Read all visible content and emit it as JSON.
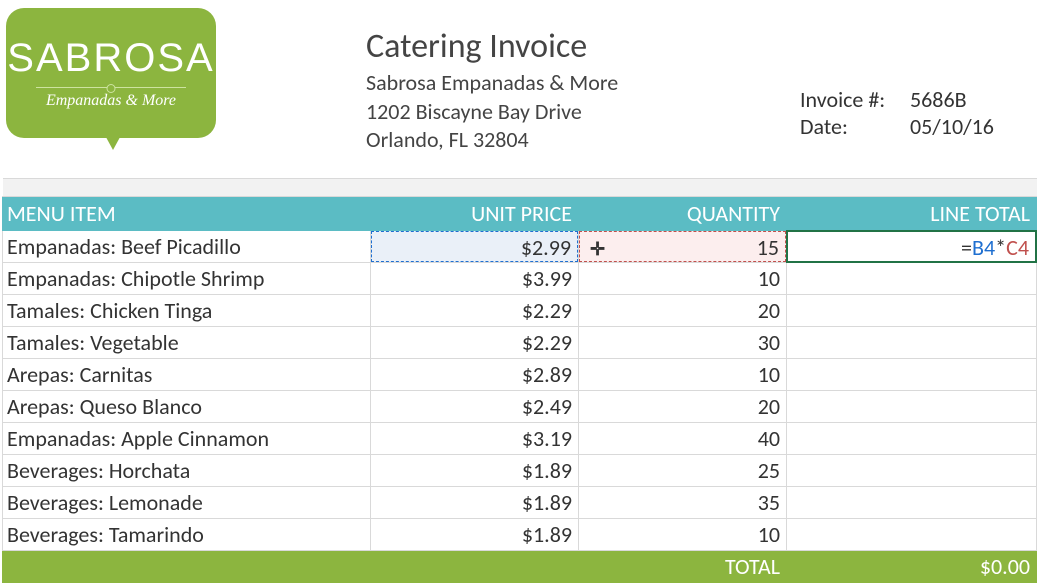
{
  "logo": {
    "title": "SABROSA",
    "subtitle": "Empanadas & More"
  },
  "vendor": {
    "title": "Catering Invoice",
    "name": "Sabrosa Empanadas & More",
    "addr1": "1202 Biscayne Bay Drive",
    "addr2": "Orlando, FL 32804"
  },
  "meta": {
    "invoice_label": "Invoice #:",
    "invoice_value": "5686B",
    "date_label": "Date:",
    "date_value": "05/10/16"
  },
  "columns": {
    "menu": "MENU ITEM",
    "unit": "UNIT PRICE",
    "qty": "QUANTITY",
    "line": "LINE TOTAL"
  },
  "rows": [
    {
      "menu": "Empanadas: Beef Picadillo",
      "unit": "$2.99",
      "qty": "15"
    },
    {
      "menu": "Empanadas: Chipotle Shrimp",
      "unit": "$3.99",
      "qty": "10"
    },
    {
      "menu": "Tamales: Chicken Tinga",
      "unit": "$2.29",
      "qty": "20"
    },
    {
      "menu": "Tamales: Vegetable",
      "unit": "$2.29",
      "qty": "30"
    },
    {
      "menu": "Arepas: Carnitas",
      "unit": "$2.89",
      "qty": "10"
    },
    {
      "menu": "Arepas: Queso Blanco",
      "unit": "$2.49",
      "qty": "20"
    },
    {
      "menu": "Empanadas: Apple Cinnamon",
      "unit": "$3.19",
      "qty": "40"
    },
    {
      "menu": "Beverages: Horchata",
      "unit": "$1.89",
      "qty": "25"
    },
    {
      "menu": "Beverages: Lemonade",
      "unit": "$1.89",
      "qty": "35"
    },
    {
      "menu": "Beverages: Tamarindo",
      "unit": "$1.89",
      "qty": "10"
    }
  ],
  "formula": {
    "eq": "=",
    "ref1": "B4",
    "op": "*",
    "ref2": "C4"
  },
  "footer": {
    "total_label": "TOTAL",
    "total_value": "$0.00"
  }
}
